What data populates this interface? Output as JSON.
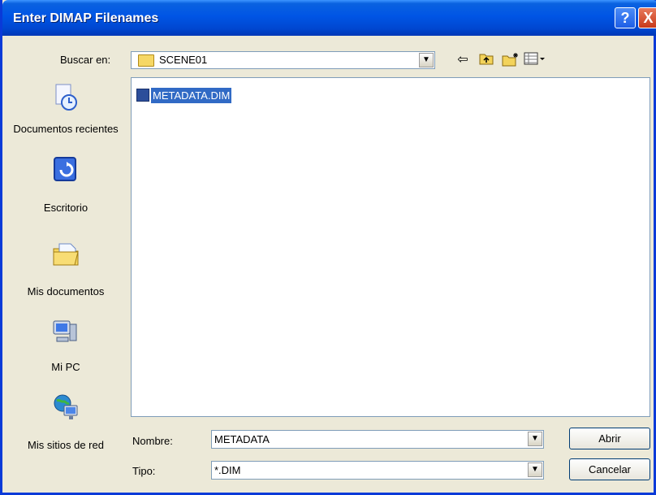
{
  "window": {
    "title": "Enter DIMAP Filenames",
    "help": "?",
    "close": "X"
  },
  "lookin": {
    "label": "Buscar en:",
    "value": "SCENE01"
  },
  "toolbar": {
    "back": "⇦",
    "up": "⬆",
    "new_folder": "✱",
    "views": "▦▾"
  },
  "places": [
    {
      "label": "Documentos recientes",
      "icon": "recent-documents-icon"
    },
    {
      "label": "Escritorio",
      "icon": "desktop-icon"
    },
    {
      "label": "Mis documentos",
      "icon": "my-documents-icon"
    },
    {
      "label": "Mi PC",
      "icon": "my-computer-icon"
    },
    {
      "label": "Mis sitios de red",
      "icon": "network-places-icon"
    }
  ],
  "files": [
    {
      "name": "METADATA.DIM",
      "selected": true
    }
  ],
  "filename": {
    "label": "Nombre:",
    "value": "METADATA"
  },
  "filetype": {
    "label": "Tipo:",
    "value": "*.DIM"
  },
  "buttons": {
    "open": "Abrir",
    "cancel": "Cancelar"
  }
}
